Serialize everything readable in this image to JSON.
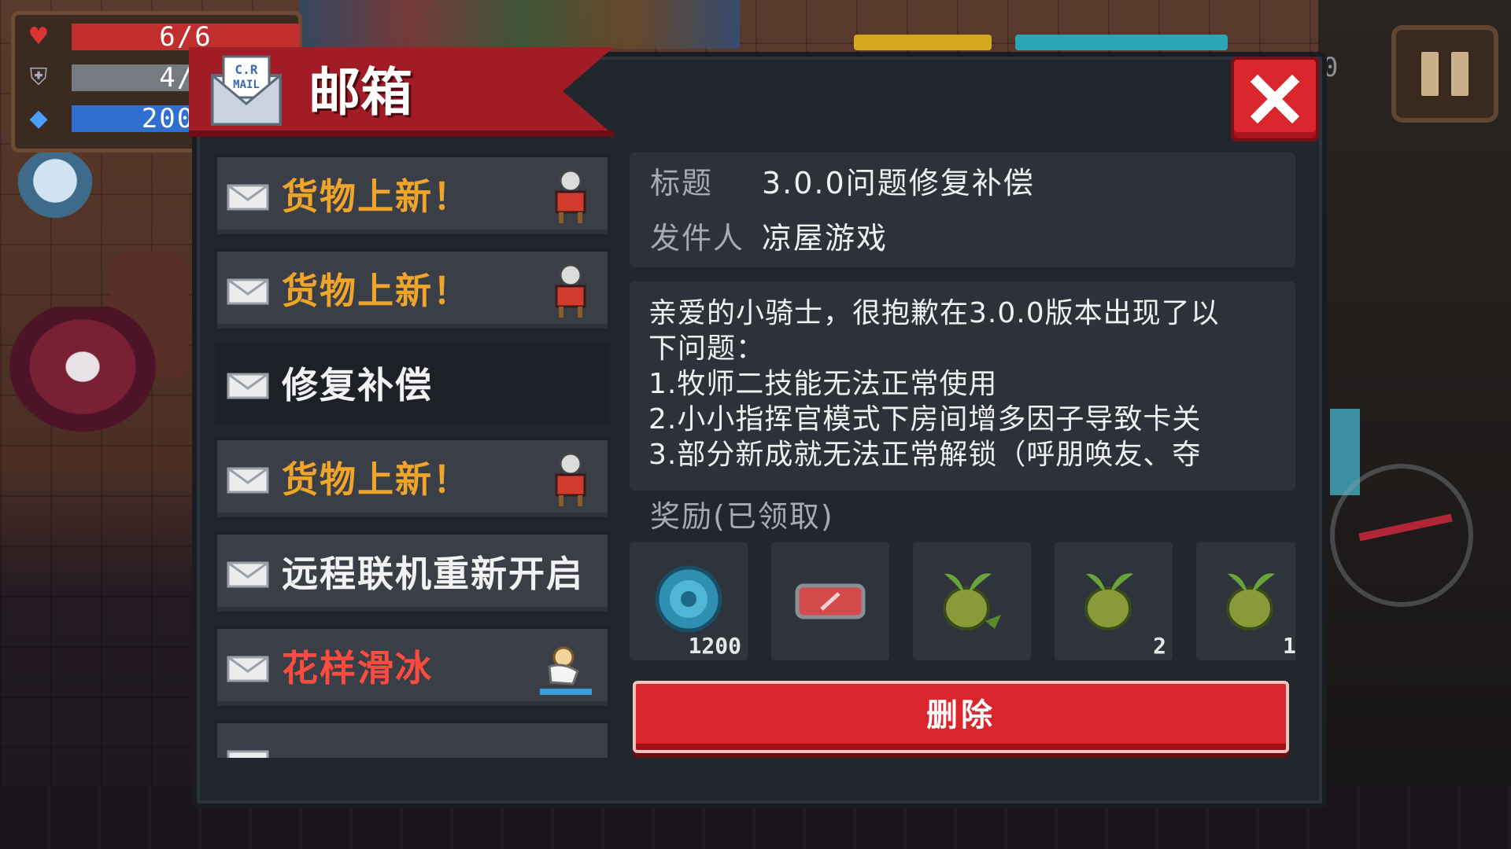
{
  "hud": {
    "health": "6/6",
    "armor": "4/4",
    "energy": "200/2"
  },
  "background": {
    "counter_fragment": "0"
  },
  "dialog": {
    "title": "邮箱",
    "close_icon": "close-x-icon"
  },
  "mail_list": [
    {
      "label": "货物上新！",
      "color": "#f0a52a",
      "icon": "merchant-icon",
      "selected": false
    },
    {
      "label": "货物上新！",
      "color": "#f0a52a",
      "icon": "merchant-icon",
      "selected": false
    },
    {
      "label": "修复补偿",
      "color": "#f2f2f2",
      "icon": "",
      "selected": true
    },
    {
      "label": "货物上新！",
      "color": "#f0a52a",
      "icon": "merchant-icon",
      "selected": false
    },
    {
      "label": "远程联机重新开启",
      "color": "#f2f2f2",
      "icon": "",
      "selected": false
    },
    {
      "label": "花样滑冰",
      "color": "#ff4b3e",
      "icon": "skater-icon",
      "selected": false
    }
  ],
  "detail": {
    "title_label": "标题",
    "title_value": "3.0.0问题修复补偿",
    "sender_label": "发件人",
    "sender_value": "凉屋游戏",
    "body_lines": [
      "亲爱的小骑士，很抱歉在3.0.0版本出现了以",
      "下问题：",
      "1.牧师二技能无法正常使用",
      "2.小小指挥官模式下房间增多因子导致卡关",
      "3.部分新成就无法正常解锁（呼朋唤友、夺"
    ],
    "reward_title": "奖励(已领取)",
    "rewards": [
      {
        "icon": "gem-coin-icon",
        "count": "1200"
      },
      {
        "icon": "ticket-icon",
        "count": ""
      },
      {
        "icon": "seed-pouch-icon",
        "count": ""
      },
      {
        "icon": "seed-pouch-icon",
        "count": "2"
      },
      {
        "icon": "seed-pouch-icon",
        "count": "1"
      }
    ],
    "delete_label": "删除"
  },
  "colors": {
    "accent_red": "#d9252b",
    "banner_red": "#a11c25",
    "orange_text": "#f0a52a",
    "panel_bg": "#22262d"
  }
}
